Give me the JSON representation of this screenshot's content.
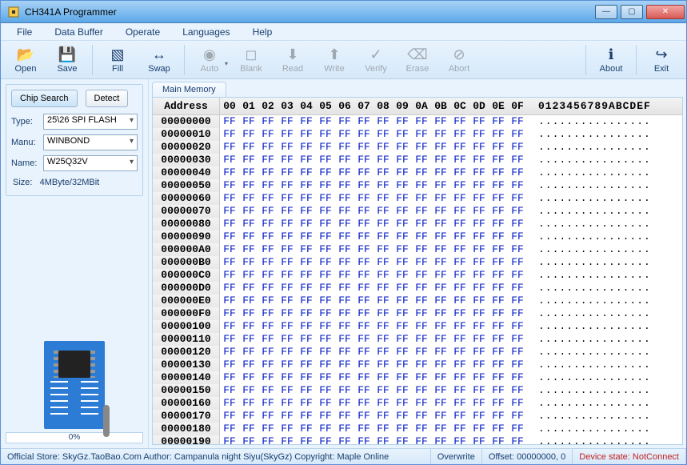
{
  "window": {
    "title": "CH341A Programmer"
  },
  "menubar": {
    "file": "File",
    "databuffer": "Data Buffer",
    "operate": "Operate",
    "languages": "Languages",
    "help": "Help"
  },
  "toolbar": {
    "open": "Open",
    "save": "Save",
    "fill": "Fill",
    "swap": "Swap",
    "auto": "Auto",
    "blank": "Blank",
    "read": "Read",
    "write": "Write",
    "verify": "Verify",
    "erase": "Erase",
    "abort": "Abort",
    "about": "About",
    "exit": "Exit"
  },
  "left": {
    "chip_search": "Chip Search",
    "detect": "Detect",
    "type_label": "Type:",
    "type_value": "25\\26 SPI FLASH",
    "manu_label": "Manu:",
    "manu_value": "WINBOND",
    "name_label": "Name:",
    "name_value": "W25Q32V",
    "size_label": "Size:",
    "size_value": "4MByte/32MBit",
    "progress": "0%"
  },
  "hex": {
    "tab": "Main Memory",
    "addr_header": "Address",
    "byte_headers": [
      "00",
      "01",
      "02",
      "03",
      "04",
      "05",
      "06",
      "07",
      "08",
      "09",
      "0A",
      "0B",
      "0C",
      "0D",
      "0E",
      "0F"
    ],
    "ascii_header": "0123456789ABCDEF",
    "rows": [
      {
        "addr": "00000000",
        "bytes": [
          "FF",
          "FF",
          "FF",
          "FF",
          "FF",
          "FF",
          "FF",
          "FF",
          "FF",
          "FF",
          "FF",
          "FF",
          "FF",
          "FF",
          "FF",
          "FF"
        ],
        "ascii": "................"
      },
      {
        "addr": "00000010",
        "bytes": [
          "FF",
          "FF",
          "FF",
          "FF",
          "FF",
          "FF",
          "FF",
          "FF",
          "FF",
          "FF",
          "FF",
          "FF",
          "FF",
          "FF",
          "FF",
          "FF"
        ],
        "ascii": "................"
      },
      {
        "addr": "00000020",
        "bytes": [
          "FF",
          "FF",
          "FF",
          "FF",
          "FF",
          "FF",
          "FF",
          "FF",
          "FF",
          "FF",
          "FF",
          "FF",
          "FF",
          "FF",
          "FF",
          "FF"
        ],
        "ascii": "................"
      },
      {
        "addr": "00000030",
        "bytes": [
          "FF",
          "FF",
          "FF",
          "FF",
          "FF",
          "FF",
          "FF",
          "FF",
          "FF",
          "FF",
          "FF",
          "FF",
          "FF",
          "FF",
          "FF",
          "FF"
        ],
        "ascii": "................"
      },
      {
        "addr": "00000040",
        "bytes": [
          "FF",
          "FF",
          "FF",
          "FF",
          "FF",
          "FF",
          "FF",
          "FF",
          "FF",
          "FF",
          "FF",
          "FF",
          "FF",
          "FF",
          "FF",
          "FF"
        ],
        "ascii": "................"
      },
      {
        "addr": "00000050",
        "bytes": [
          "FF",
          "FF",
          "FF",
          "FF",
          "FF",
          "FF",
          "FF",
          "FF",
          "FF",
          "FF",
          "FF",
          "FF",
          "FF",
          "FF",
          "FF",
          "FF"
        ],
        "ascii": "................"
      },
      {
        "addr": "00000060",
        "bytes": [
          "FF",
          "FF",
          "FF",
          "FF",
          "FF",
          "FF",
          "FF",
          "FF",
          "FF",
          "FF",
          "FF",
          "FF",
          "FF",
          "FF",
          "FF",
          "FF"
        ],
        "ascii": "................"
      },
      {
        "addr": "00000070",
        "bytes": [
          "FF",
          "FF",
          "FF",
          "FF",
          "FF",
          "FF",
          "FF",
          "FF",
          "FF",
          "FF",
          "FF",
          "FF",
          "FF",
          "FF",
          "FF",
          "FF"
        ],
        "ascii": "................"
      },
      {
        "addr": "00000080",
        "bytes": [
          "FF",
          "FF",
          "FF",
          "FF",
          "FF",
          "FF",
          "FF",
          "FF",
          "FF",
          "FF",
          "FF",
          "FF",
          "FF",
          "FF",
          "FF",
          "FF"
        ],
        "ascii": "................"
      },
      {
        "addr": "00000090",
        "bytes": [
          "FF",
          "FF",
          "FF",
          "FF",
          "FF",
          "FF",
          "FF",
          "FF",
          "FF",
          "FF",
          "FF",
          "FF",
          "FF",
          "FF",
          "FF",
          "FF"
        ],
        "ascii": "................"
      },
      {
        "addr": "000000A0",
        "bytes": [
          "FF",
          "FF",
          "FF",
          "FF",
          "FF",
          "FF",
          "FF",
          "FF",
          "FF",
          "FF",
          "FF",
          "FF",
          "FF",
          "FF",
          "FF",
          "FF"
        ],
        "ascii": "................"
      },
      {
        "addr": "000000B0",
        "bytes": [
          "FF",
          "FF",
          "FF",
          "FF",
          "FF",
          "FF",
          "FF",
          "FF",
          "FF",
          "FF",
          "FF",
          "FF",
          "FF",
          "FF",
          "FF",
          "FF"
        ],
        "ascii": "................"
      },
      {
        "addr": "000000C0",
        "bytes": [
          "FF",
          "FF",
          "FF",
          "FF",
          "FF",
          "FF",
          "FF",
          "FF",
          "FF",
          "FF",
          "FF",
          "FF",
          "FF",
          "FF",
          "FF",
          "FF"
        ],
        "ascii": "................"
      },
      {
        "addr": "000000D0",
        "bytes": [
          "FF",
          "FF",
          "FF",
          "FF",
          "FF",
          "FF",
          "FF",
          "FF",
          "FF",
          "FF",
          "FF",
          "FF",
          "FF",
          "FF",
          "FF",
          "FF"
        ],
        "ascii": "................"
      },
      {
        "addr": "000000E0",
        "bytes": [
          "FF",
          "FF",
          "FF",
          "FF",
          "FF",
          "FF",
          "FF",
          "FF",
          "FF",
          "FF",
          "FF",
          "FF",
          "FF",
          "FF",
          "FF",
          "FF"
        ],
        "ascii": "................"
      },
      {
        "addr": "000000F0",
        "bytes": [
          "FF",
          "FF",
          "FF",
          "FF",
          "FF",
          "FF",
          "FF",
          "FF",
          "FF",
          "FF",
          "FF",
          "FF",
          "FF",
          "FF",
          "FF",
          "FF"
        ],
        "ascii": "................"
      },
      {
        "addr": "00000100",
        "bytes": [
          "FF",
          "FF",
          "FF",
          "FF",
          "FF",
          "FF",
          "FF",
          "FF",
          "FF",
          "FF",
          "FF",
          "FF",
          "FF",
          "FF",
          "FF",
          "FF"
        ],
        "ascii": "................"
      },
      {
        "addr": "00000110",
        "bytes": [
          "FF",
          "FF",
          "FF",
          "FF",
          "FF",
          "FF",
          "FF",
          "FF",
          "FF",
          "FF",
          "FF",
          "FF",
          "FF",
          "FF",
          "FF",
          "FF"
        ],
        "ascii": "................"
      },
      {
        "addr": "00000120",
        "bytes": [
          "FF",
          "FF",
          "FF",
          "FF",
          "FF",
          "FF",
          "FF",
          "FF",
          "FF",
          "FF",
          "FF",
          "FF",
          "FF",
          "FF",
          "FF",
          "FF"
        ],
        "ascii": "................"
      },
      {
        "addr": "00000130",
        "bytes": [
          "FF",
          "FF",
          "FF",
          "FF",
          "FF",
          "FF",
          "FF",
          "FF",
          "FF",
          "FF",
          "FF",
          "FF",
          "FF",
          "FF",
          "FF",
          "FF"
        ],
        "ascii": "................"
      },
      {
        "addr": "00000140",
        "bytes": [
          "FF",
          "FF",
          "FF",
          "FF",
          "FF",
          "FF",
          "FF",
          "FF",
          "FF",
          "FF",
          "FF",
          "FF",
          "FF",
          "FF",
          "FF",
          "FF"
        ],
        "ascii": "................"
      },
      {
        "addr": "00000150",
        "bytes": [
          "FF",
          "FF",
          "FF",
          "FF",
          "FF",
          "FF",
          "FF",
          "FF",
          "FF",
          "FF",
          "FF",
          "FF",
          "FF",
          "FF",
          "FF",
          "FF"
        ],
        "ascii": "................"
      },
      {
        "addr": "00000160",
        "bytes": [
          "FF",
          "FF",
          "FF",
          "FF",
          "FF",
          "FF",
          "FF",
          "FF",
          "FF",
          "FF",
          "FF",
          "FF",
          "FF",
          "FF",
          "FF",
          "FF"
        ],
        "ascii": "................"
      },
      {
        "addr": "00000170",
        "bytes": [
          "FF",
          "FF",
          "FF",
          "FF",
          "FF",
          "FF",
          "FF",
          "FF",
          "FF",
          "FF",
          "FF",
          "FF",
          "FF",
          "FF",
          "FF",
          "FF"
        ],
        "ascii": "................"
      },
      {
        "addr": "00000180",
        "bytes": [
          "FF",
          "FF",
          "FF",
          "FF",
          "FF",
          "FF",
          "FF",
          "FF",
          "FF",
          "FF",
          "FF",
          "FF",
          "FF",
          "FF",
          "FF",
          "FF"
        ],
        "ascii": "................"
      },
      {
        "addr": "00000190",
        "bytes": [
          "FF",
          "FF",
          "FF",
          "FF",
          "FF",
          "FF",
          "FF",
          "FF",
          "FF",
          "FF",
          "FF",
          "FF",
          "FF",
          "FF",
          "FF",
          "FF"
        ],
        "ascii": "................"
      }
    ]
  },
  "statusbar": {
    "copyright": "Official Store: SkyGz.TaoBao.Com Author: Campanula night Siyu(SkyGz) Copyright: Maple Online",
    "overwrite": "Overwrite",
    "offset": "Offset: 00000000, 0",
    "device_state": "Device state: NotConnect"
  },
  "icons": {
    "open": "📂",
    "save": "💾",
    "fill": "▧",
    "swap": "↔",
    "auto": "◉",
    "blank": "◻",
    "read": "⬇",
    "write": "⬆",
    "verify": "✓",
    "erase": "⌫",
    "abort": "⊘",
    "about": "ℹ",
    "exit": "↪"
  }
}
